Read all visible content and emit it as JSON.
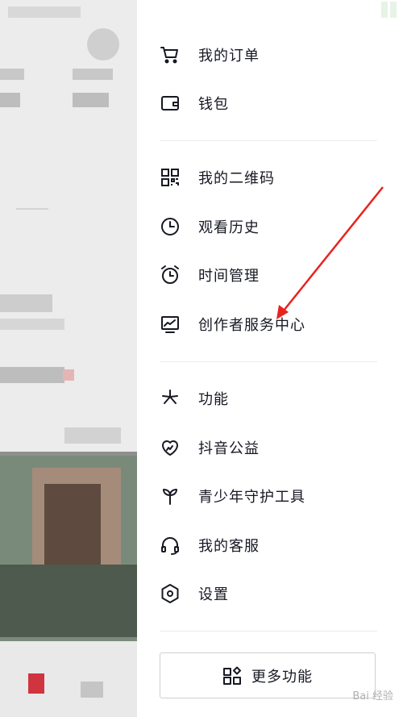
{
  "drawer": {
    "items": [
      {
        "label": "我的订单",
        "icon": "cart-icon"
      },
      {
        "label": "钱包",
        "icon": "wallet-icon"
      },
      {
        "label": "我的二维码",
        "icon": "qr-code-icon"
      },
      {
        "label": "观看历史",
        "icon": "clock-icon"
      },
      {
        "label": "时间管理",
        "icon": "alarm-clock-icon"
      },
      {
        "label": "创作者服务中心",
        "icon": "monitor-chart-icon"
      },
      {
        "label": "功能",
        "icon": "sparkle-icon"
      },
      {
        "label": "抖音公益",
        "icon": "heart-hands-icon"
      },
      {
        "label": "青少年守护工具",
        "icon": "sprout-icon"
      },
      {
        "label": "我的客服",
        "icon": "headset-icon"
      },
      {
        "label": "设置",
        "icon": "hexagon-gear-icon"
      }
    ],
    "more_button": {
      "label": "更多功能",
      "icon": "grid-diamond-icon"
    }
  },
  "annotation": {
    "color": "#e8231e"
  },
  "watermark": {
    "text": "Bai 经验"
  }
}
